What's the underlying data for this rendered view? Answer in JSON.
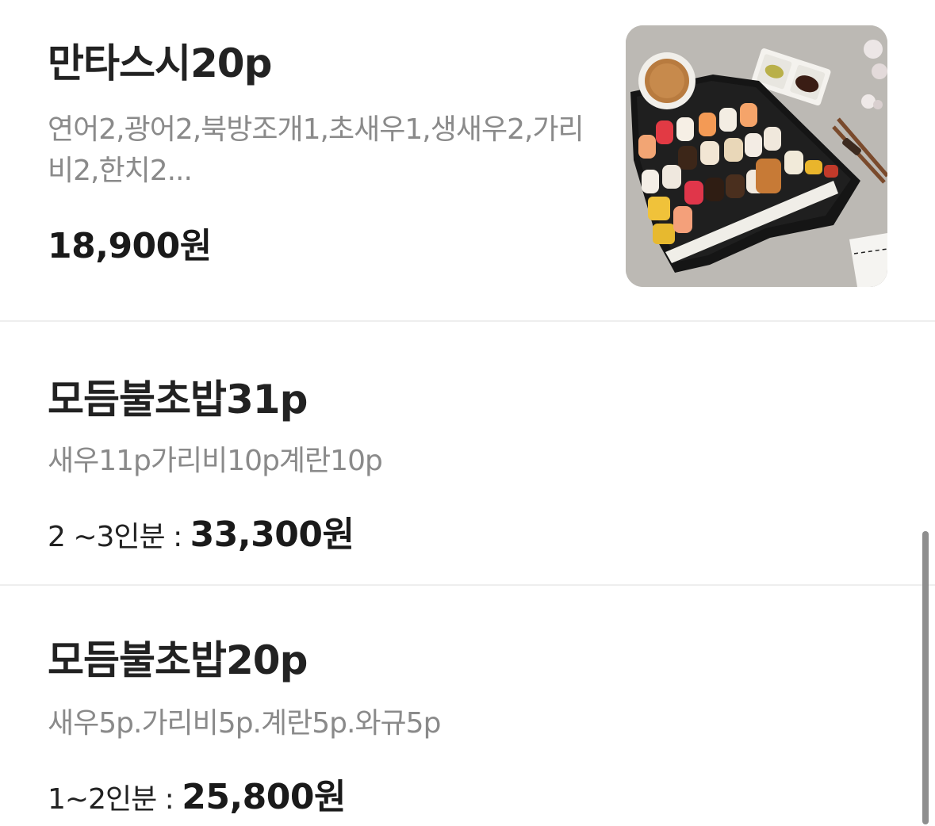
{
  "menu": {
    "items": [
      {
        "name": "만타스시20p",
        "description": "연어2,광어2,북방조개1,초새우1,생새우2,가리비2,한치2...",
        "serving": "",
        "price": "18,900원",
        "image": "sushi-platter-thumbnail"
      },
      {
        "name": "모듬불초밥31p",
        "description": "새우11p가리비10p계란10p",
        "serving": "2 ~3인분 : ",
        "price": "33,300원"
      },
      {
        "name": "모듬불초밥20p",
        "description": "새우5p.가리비5p.계란5p.와규5p",
        "serving": "1~2인분 : ",
        "price": "25,800원"
      }
    ]
  },
  "colors": {
    "title": "#222222",
    "description": "#8a8a8a",
    "divider": "#eeeeee",
    "scrollbar": "#8e8e8e"
  }
}
